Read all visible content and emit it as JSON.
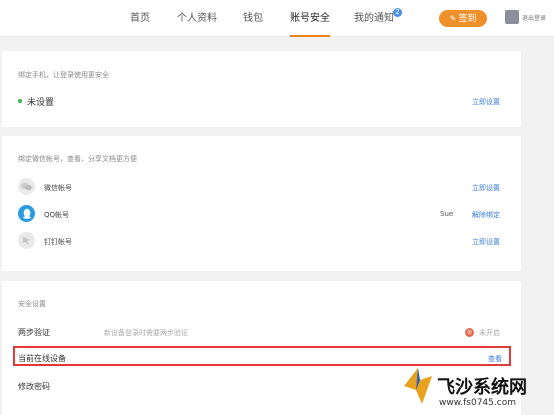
{
  "nav": {
    "items": [
      "首页",
      "个人资料",
      "钱包",
      "账号安全",
      "我的通知"
    ],
    "notification_badge": "2",
    "checkin": "签到",
    "logout": "退出登录"
  },
  "phone": {
    "title": "绑定手机，让登录使用更安全",
    "status": "未设置",
    "action": "立即设置"
  },
  "accounts": {
    "title": "绑定微信帐号，查看、分享文档更方便",
    "wechat_label": "微信帐号",
    "wechat_action": "立即设置",
    "qq_label": "QQ帐号",
    "qq_name": "Sue",
    "qq_action": "解除绑定",
    "dingtalk_label": "钉钉帐号",
    "dingtalk_action": "立即设置"
  },
  "security": {
    "title": "安全设置",
    "two_step_label": "两步验证",
    "two_step_desc": "新设备登录时需要两步验证",
    "two_step_status": "未开启",
    "devices_label": "当前在线设备",
    "devices_action": "查看",
    "password_label": "修改密码"
  },
  "watermark": {
    "brand": "飞沙系统网",
    "url": "www.fs0745.com"
  },
  "colors": {
    "accent_orange": "#f0902b",
    "link_blue": "#3b7ed6",
    "highlight_red": "#e03a3a",
    "status_green": "#3ab54a"
  }
}
